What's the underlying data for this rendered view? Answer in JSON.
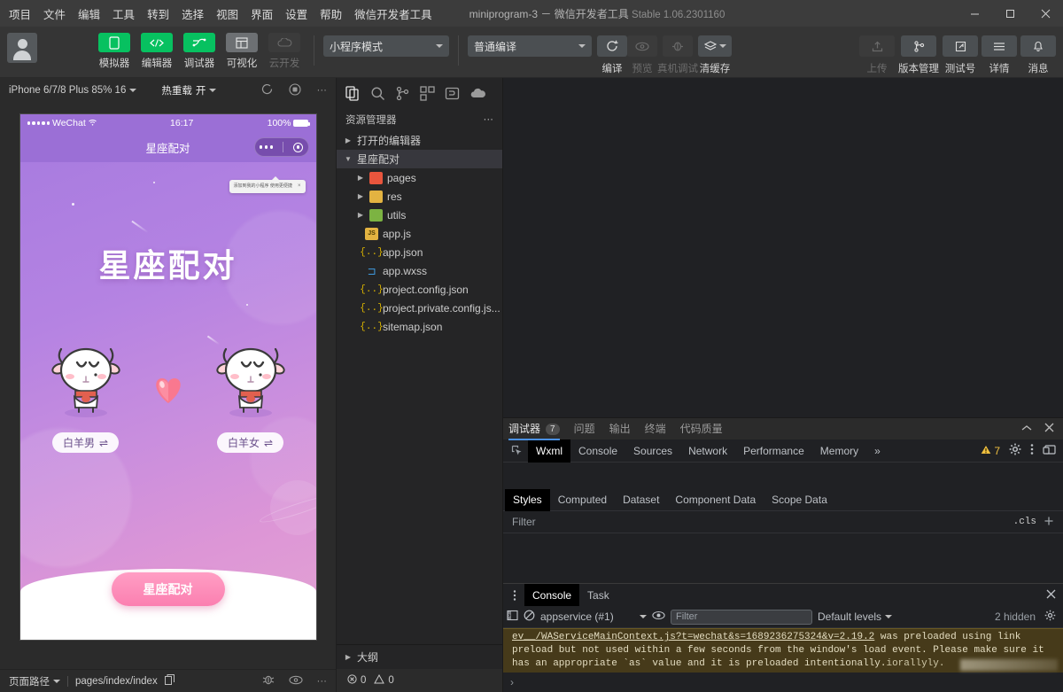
{
  "titlebar": {
    "menus": [
      "项目",
      "文件",
      "编辑",
      "工具",
      "转到",
      "选择",
      "视图",
      "界面",
      "设置",
      "帮助",
      "微信开发者工具"
    ],
    "project_title": "miniprogram-3 － 微信开发者工具",
    "version": "Stable 1.06.2301160",
    "window_buttons": [
      "minimize-button",
      "maximize-button",
      "close-button"
    ]
  },
  "toolbar": {
    "left_buttons": [
      {
        "label": "模拟器",
        "icon": "phone-icon",
        "state": "green"
      },
      {
        "label": "编辑器",
        "icon": "code-icon",
        "state": "green"
      },
      {
        "label": "调试器",
        "icon": "debug-icon",
        "state": "green"
      },
      {
        "label": "可视化",
        "icon": "layout-icon",
        "state": "gray"
      },
      {
        "label": "云开发",
        "icon": "cloud-icon",
        "state": "disabled"
      }
    ],
    "mode_select": "小程序模式",
    "compile_select": "普通编译",
    "actions": [
      {
        "label": "编译",
        "icon": "refresh-icon",
        "state": "enabled"
      },
      {
        "label": "预览",
        "icon": "eye-icon",
        "state": "disabled"
      },
      {
        "label": "真机调试",
        "icon": "device-debug-icon",
        "state": "disabled"
      },
      {
        "label": "清缓存",
        "icon": "layers-icon",
        "state": "enabled"
      }
    ],
    "right_buttons": [
      {
        "label": "上传",
        "icon": "upload-icon",
        "state": "disabled"
      },
      {
        "label": "版本管理",
        "icon": "branch-icon",
        "state": "enabled"
      },
      {
        "label": "测试号",
        "icon": "external-link-icon",
        "state": "enabled"
      },
      {
        "label": "详情",
        "icon": "menu-icon",
        "state": "enabled"
      },
      {
        "label": "消息",
        "icon": "bell-icon",
        "state": "enabled"
      }
    ]
  },
  "simulator": {
    "device": "iPhone 6/7/8 Plus 85% 16",
    "hotreload_label": "热重载",
    "hotreload_value": "开",
    "icons": [
      "refresh-icon",
      "record-icon",
      "more-icon"
    ],
    "phone": {
      "status_carrier": "WeChat",
      "status_time": "16:17",
      "status_battery": "100%",
      "nav_title": "星座配对",
      "tooltip": "添加到我的小程序 使用更便捷",
      "tooltip_close": "×",
      "page_title": "星座配对",
      "left_pill": "白羊男",
      "right_pill": "白羊女",
      "pill_icon": "⇌",
      "match_button": "星座配对"
    },
    "statusbar": {
      "path_label": "页面路径",
      "path_value": "pages/index/index",
      "copy_icon": "copy-icon",
      "icons": [
        "bug-icon",
        "eye-icon",
        "more-icon"
      ]
    }
  },
  "explorer": {
    "activity_icons": [
      "files-icon",
      "search-icon",
      "source-control-icon",
      "extensions-icon",
      "snippet-icon",
      "cloud-debug-icon"
    ],
    "header": "资源管理器",
    "more_icon": "···",
    "sections": [
      {
        "label": "打开的编辑器",
        "expanded": false,
        "depth": 0
      },
      {
        "label": "星座配对",
        "expanded": true,
        "depth": 0,
        "selected": true
      }
    ],
    "files": [
      {
        "name": "pages",
        "type": "folder",
        "color": "red",
        "depth": 1
      },
      {
        "name": "res",
        "type": "folder",
        "color": "yellow",
        "depth": 1
      },
      {
        "name": "utils",
        "type": "folder",
        "color": "green",
        "depth": 1
      },
      {
        "name": "app.js",
        "type": "js",
        "depth": 2
      },
      {
        "name": "app.json",
        "type": "json",
        "depth": 2
      },
      {
        "name": "app.wxss",
        "type": "wxss",
        "depth": 2
      },
      {
        "name": "project.config.json",
        "type": "json",
        "depth": 2
      },
      {
        "name": "project.private.config.js...",
        "type": "json",
        "depth": 2
      },
      {
        "name": "sitemap.json",
        "type": "json",
        "depth": 2
      }
    ],
    "outline": "大纲",
    "status_errors": "0",
    "status_warnings": "0"
  },
  "devtools": {
    "panel_tabs": [
      {
        "label": "调试器",
        "badge": "7",
        "active": true
      },
      {
        "label": "问题",
        "active": false
      },
      {
        "label": "输出",
        "active": false
      },
      {
        "label": "终端",
        "active": false
      },
      {
        "label": "代码质量",
        "active": false
      }
    ],
    "panel_controls": [
      "collapse-icon",
      "close-icon"
    ],
    "inspector_tabs": [
      "Wxml",
      "Console",
      "Sources",
      "Network",
      "Performance",
      "Memory"
    ],
    "inspector_active": "Wxml",
    "inspector_overflow": "»",
    "warning_count": "7",
    "inspector_right_icons": [
      "settings-icon",
      "more-icon",
      "dock-icon"
    ],
    "styles_tabs": [
      "Styles",
      "Computed",
      "Dataset",
      "Component Data",
      "Scope Data"
    ],
    "styles_active": "Styles",
    "filter_placeholder": "Filter",
    "cls_label": ".cls",
    "add_rule_icon": "+",
    "console": {
      "tabs": [
        "Console",
        "Task"
      ],
      "active_tab": "Console",
      "close_icon": "×",
      "context": "appservice (#1)",
      "filter_placeholder": "Filter",
      "levels": "Default levels",
      "hidden_count": "2 hidden",
      "settings_icon": "gear-icon",
      "message_link": "ev__/WAServiceMainContext.js?t=wechat&s=1689236275324&v=2.19.2",
      "message_body": " was preloaded using link preload but not used within a few seconds from the window's load event. Please make sure it has an appropriate `as` value and it is preloaded intentionally.",
      "message_tail": "iorallyly.",
      "prompt": "›"
    }
  },
  "colors": {
    "wechat_green": "#07c160",
    "accent_blue": "#4a90e2",
    "warn_yellow": "#f0c040",
    "phone_purple": "#9b6fd6",
    "pink_button": "#fb7fb0"
  }
}
